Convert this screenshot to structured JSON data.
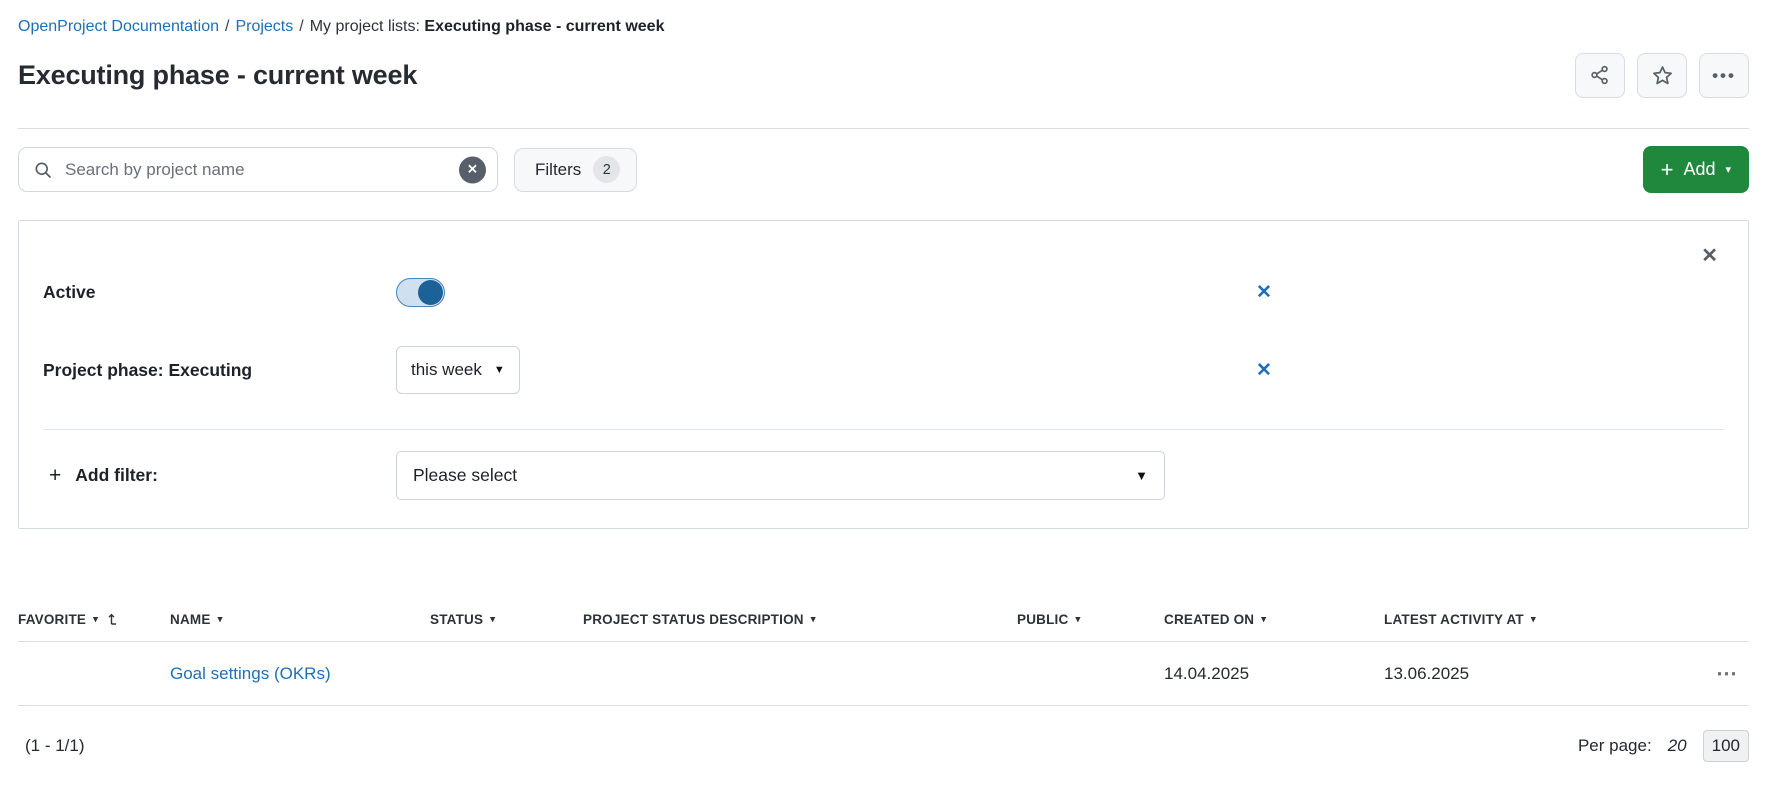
{
  "breadcrumb": {
    "links": [
      {
        "label": "OpenProject Documentation"
      },
      {
        "label": "Projects"
      }
    ],
    "separator": "/",
    "current_prefix": "My project lists: ",
    "current": "Executing phase - current week"
  },
  "header": {
    "title": "Executing phase - current week"
  },
  "toolbar": {
    "search_placeholder": "Search by project name",
    "search_value": "",
    "filters_label": "Filters",
    "filters_count": "2",
    "add_label": "Add"
  },
  "filter_panel": {
    "active_filter": {
      "label": "Active",
      "state": "on"
    },
    "phase_filter": {
      "label": "Project phase: Executing",
      "value": "this week"
    },
    "add_filter_label": "Add filter:",
    "add_filter_placeholder": "Please select"
  },
  "table": {
    "columns": [
      "FAVORITE",
      "NAME",
      "STATUS",
      "PROJECT STATUS DESCRIPTION",
      "PUBLIC",
      "CREATED ON",
      "LATEST ACTIVITY AT"
    ],
    "rows": [
      {
        "favorite": "",
        "name": "Goal settings (OKRs)",
        "status": "",
        "project_status_description": "",
        "public": "",
        "created_on": "14.04.2025",
        "latest_activity_at": "13.06.2025"
      }
    ]
  },
  "footer": {
    "range": "(1 - 1/1)",
    "per_page_label": "Per page:",
    "per_page_options": [
      "20",
      "100"
    ],
    "per_page_selected": "100"
  },
  "icons": {
    "plus": "+",
    "caret_down": "▾",
    "dropdown_arrow": "▼",
    "close": "✕",
    "remove_filter": "✕",
    "clear_search": "✕",
    "ellipsis": "⋯",
    "share": "share-network-icon",
    "star": "star-outline-icon",
    "more": "more-options-icon",
    "search": "magnifier-icon",
    "sort": "sort-ascending-icon"
  },
  "colors": {
    "link_blue": "#1d6fb8",
    "add_green": "#1f883d",
    "toggle_knob_blue": "#1d6199",
    "toggle_track_blue": "#cfe0f0",
    "border_gray": "#d0d7de",
    "icon_gray": "#575f66"
  }
}
